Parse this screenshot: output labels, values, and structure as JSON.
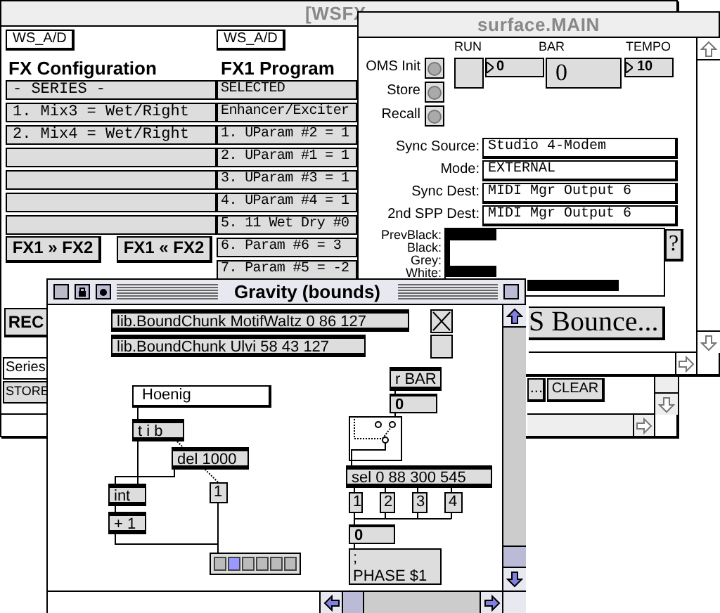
{
  "fx_window": {
    "title": "[WSFX",
    "active": false,
    "config": {
      "device": "WS_A/D",
      "heading": "FX Configuration",
      "rows": [
        {
          "kind": "text",
          "text": "- SERIES -"
        },
        {
          "kind": "text",
          "text": "1. Mix3 = Wet/Right"
        },
        {
          "kind": "text",
          "text": "2. Mix4 = Wet/Right"
        },
        {
          "kind": "empty"
        },
        {
          "kind": "empty"
        },
        {
          "kind": "empty"
        },
        {
          "kind": "empty"
        }
      ]
    },
    "program": {
      "device": "WS_A/D",
      "heading": "FX1 Program",
      "rows": [
        "SELECTED",
        "Enhancer/Exciter",
        "1. UParam #2 = 1",
        "2. UParam #1 = 1",
        "3. UParam #3 = 1",
        "4. UParam #4 = 1",
        "5. 11 Wet Dry #0",
        "6. Param #6 = 3",
        "7. Param #5 = -2"
      ]
    },
    "transfer_buttons": [
      "FX1 » FX2",
      "FX1 « FX2"
    ],
    "rec_button": "REC",
    "series_field": "Series",
    "store_button": "STORE",
    "more_button": "...",
    "clear_button": "CLEAR"
  },
  "surface_window": {
    "title": "surface.MAIN",
    "active": false,
    "buttons": [
      "OMS Init",
      "Store",
      "Recall"
    ],
    "transport": {
      "run_label": "RUN",
      "bar_label": "BAR",
      "tempo_label": "TEMPO",
      "run_value": "0",
      "bar_value": "0",
      "tempo_value": "10"
    },
    "sync": [
      {
        "label": "Sync Source:",
        "value": "Studio 4-Modem"
      },
      {
        "label": "Mode:",
        "value": "EXTERNAL"
      },
      {
        "label": "Sync Dest:",
        "value": "MIDI Mgr Output 6"
      },
      {
        "label": "2nd SPP Dest:",
        "value": "MIDI Mgr Output 6"
      }
    ],
    "meter_labels": [
      "PrevBlack:",
      "Black:",
      "Grey:",
      "White:"
    ],
    "help_button": "?",
    "bounce_button": "S Bounce..."
  },
  "gravity_window": {
    "title": "Gravity (bounds)",
    "active": true,
    "objects": [
      {
        "kind": "object",
        "text": "lib.BoundChunk MotifWaltz 0 86 127"
      },
      {
        "kind": "object",
        "text": "lib.BoundChunk Ulvi 58 43 127"
      },
      {
        "kind": "toggle",
        "on": true
      },
      {
        "kind": "empty"
      },
      {
        "kind": "field",
        "text": "Hoenig"
      },
      {
        "kind": "object",
        "text": "t i b"
      },
      {
        "kind": "object",
        "text": "del 1000"
      },
      {
        "kind": "object",
        "text": "int"
      },
      {
        "kind": "object",
        "text": "+ 1"
      },
      {
        "kind": "message",
        "text": "1"
      },
      {
        "kind": "radio",
        "cells": [
          {
            "selected": false
          },
          {
            "selected": true
          },
          {
            "selected": false
          },
          {
            "selected": false
          },
          {
            "selected": false
          },
          {
            "selected": false
          }
        ]
      },
      {
        "kind": "object",
        "text": "r BAR"
      },
      {
        "kind": "number",
        "text": "0"
      },
      {
        "kind": "switch",
        "on": true
      },
      {
        "kind": "object",
        "text": "sel 0 88 300 545"
      },
      {
        "kind": "message",
        "text": "1"
      },
      {
        "kind": "message",
        "text": "2"
      },
      {
        "kind": "message",
        "text": "3"
      },
      {
        "kind": "message",
        "text": "4"
      },
      {
        "kind": "number",
        "text": "0"
      },
      {
        "kind": "message",
        "lines": [
          ";",
          "PHASE $1"
        ]
      }
    ]
  }
}
